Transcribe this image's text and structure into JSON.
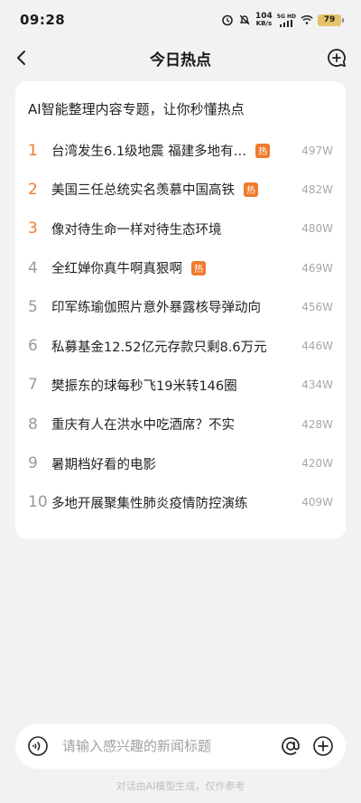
{
  "status_bar": {
    "time": "09:28",
    "net_speed_value": "104",
    "net_speed_unit": "KB/s",
    "network_label": "5G HD",
    "battery": "79"
  },
  "nav": {
    "title": "今日热点"
  },
  "card": {
    "heading": "AI智能整理内容专题，让你秒懂热点",
    "items": [
      {
        "rank": "1",
        "title": "台湾发生6.1级地震 福建多地有…",
        "hot": "热",
        "heat": "497W"
      },
      {
        "rank": "2",
        "title": "美国三任总统实名羡慕中国高铁",
        "hot": "热",
        "heat": "482W"
      },
      {
        "rank": "3",
        "title": "像对待生命一样对待生态环境",
        "hot": "",
        "heat": "480W"
      },
      {
        "rank": "4",
        "title": "全红婵你真牛啊真狠啊",
        "hot": "热",
        "heat": "469W"
      },
      {
        "rank": "5",
        "title": "印军练瑜伽照片意外暴露核导弹动向",
        "hot": "",
        "heat": "456W"
      },
      {
        "rank": "6",
        "title": "私募基金12.52亿元存款只剩8.6万元",
        "hot": "",
        "heat": "446W"
      },
      {
        "rank": "7",
        "title": "樊振东的球每秒飞19米转146圈",
        "hot": "",
        "heat": "434W"
      },
      {
        "rank": "8",
        "title": "重庆有人在洪水中吃酒席？不实",
        "hot": "",
        "heat": "428W"
      },
      {
        "rank": "9",
        "title": "暑期档好看的电影",
        "hot": "",
        "heat": "420W"
      },
      {
        "rank": "10",
        "title": "多地开展聚集性肺炎疫情防控演练",
        "hot": "",
        "heat": "409W"
      }
    ]
  },
  "input_bar": {
    "placeholder": "请输入感兴趣的新闻标题"
  },
  "footer": {
    "note": "对话由AI模型生成，仅作参考"
  },
  "colors": {
    "accent": "#f07a2c",
    "background": "#f2f2f2",
    "card": "#ffffff",
    "heat_text": "#a8a8a8"
  },
  "icons": {
    "back": "chevron-left-icon",
    "new_chat": "chat-plus-icon",
    "voice": "voice-wave-icon",
    "at": "at-sign-icon",
    "plus": "plus-circle-icon"
  }
}
